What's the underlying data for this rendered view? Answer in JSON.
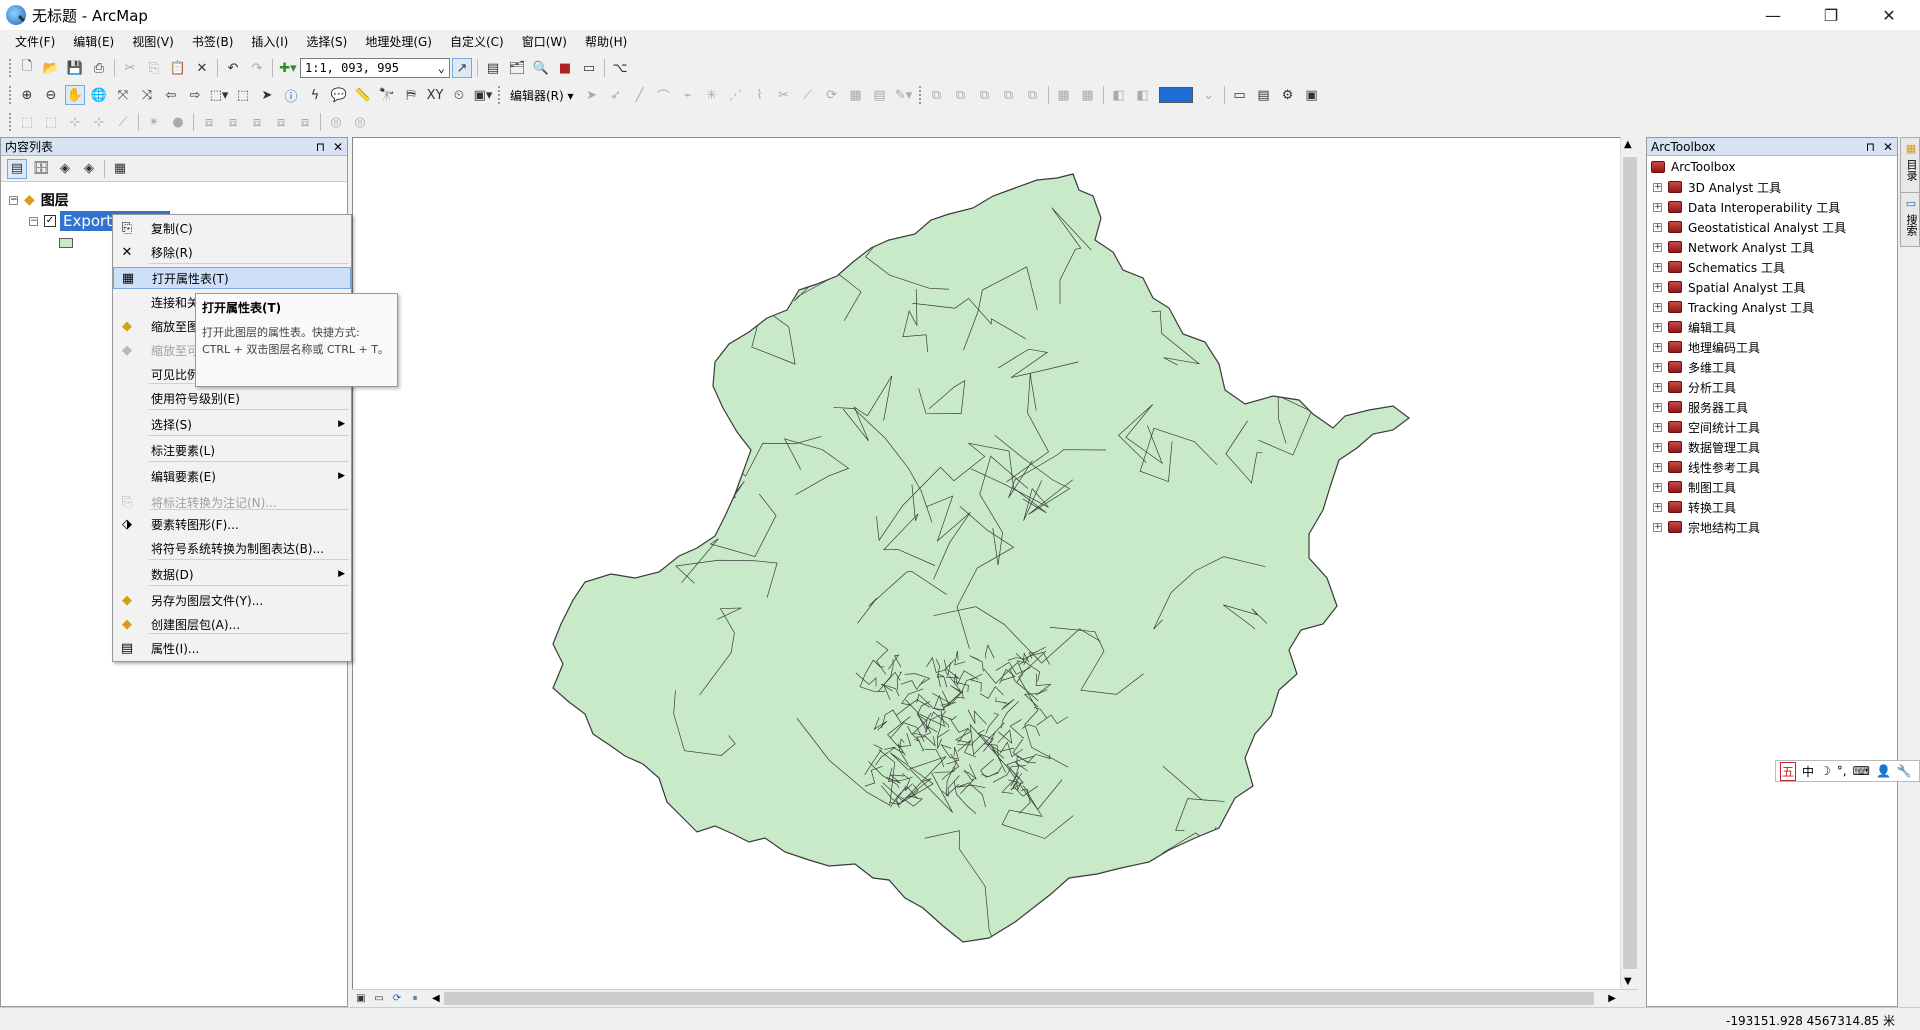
{
  "window": {
    "title": "无标题 - ArcMap",
    "minimize": "—",
    "maximize": "❐",
    "close": "✕"
  },
  "menu": [
    "文件(F)",
    "编辑(E)",
    "视图(V)",
    "书签(B)",
    "插入(I)",
    "选择(S)",
    "地理处理(G)",
    "自定义(C)",
    "窗口(W)",
    "帮助(H)"
  ],
  "toolbar": {
    "scale": "1:1, 093, 995",
    "editor_label": "编辑器(R) ▾"
  },
  "toc": {
    "title": "内容列表",
    "pin": "⊓",
    "close": "✕",
    "root_label": "图层",
    "layer_name": "Export_"
  },
  "context_menu": [
    {
      "label": "复制(C)",
      "icon": "copy-icon",
      "glyph": "⎘",
      "enabled": true
    },
    {
      "label": "移除(R)",
      "icon": "remove-icon",
      "glyph": "✕",
      "enabled": true
    },
    {
      "label": "打开属性表(T)",
      "icon": "table-icon",
      "glyph": "▦",
      "enabled": true,
      "highlighted": true
    },
    {
      "label": "连接和关联",
      "icon": "",
      "glyph": "",
      "enabled": true,
      "submenu": true
    },
    {
      "label": "缩放至图层",
      "icon": "zoom-layer-icon",
      "glyph": "◆",
      "enabled": true
    },
    {
      "label": "缩放至可见",
      "icon": "zoom-visible-icon",
      "glyph": "◆",
      "enabled": false
    },
    {
      "label": "可见比例范围",
      "icon": "",
      "glyph": "",
      "enabled": true,
      "submenu": true
    },
    {
      "label": "使用符号级别(E)",
      "icon": "",
      "glyph": "",
      "enabled": true
    },
    {
      "label": "选择(S)",
      "icon": "",
      "glyph": "",
      "enabled": true,
      "submenu": true
    },
    {
      "label": "标注要素(L)",
      "icon": "",
      "glyph": "",
      "enabled": true
    },
    {
      "label": "编辑要素(E)",
      "icon": "",
      "glyph": "",
      "enabled": true,
      "submenu": true
    },
    {
      "label": "将标注转换为注记(N)...",
      "icon": "convert-label-icon",
      "glyph": "⎘",
      "enabled": false
    },
    {
      "label": "要素转图形(F)...",
      "icon": "feature-graphic-icon",
      "glyph": "⬗",
      "enabled": true
    },
    {
      "label": "将符号系统转换为制图表达(B)...",
      "icon": "",
      "glyph": "",
      "enabled": true
    },
    {
      "label": "数据(D)",
      "icon": "",
      "glyph": "",
      "enabled": true,
      "submenu": true
    },
    {
      "label": "另存为图层文件(Y)...",
      "icon": "layer-file-icon",
      "glyph": "◆",
      "enabled": true
    },
    {
      "label": "创建图层包(A)...",
      "icon": "layer-package-icon",
      "glyph": "◆",
      "enabled": true
    },
    {
      "label": "属性(I)...",
      "icon": "properties-icon",
      "glyph": "▤",
      "enabled": true
    }
  ],
  "tooltip": {
    "title": "打开属性表(T)",
    "body": "打开此图层的属性表。快捷方式: CTRL + 双击图层名称或 CTRL + T。"
  },
  "toolbox": {
    "title": "ArcToolbox",
    "root": "ArcToolbox",
    "items": [
      "3D Analyst 工具",
      "Data Interoperability 工具",
      "Geostatistical Analyst 工具",
      "Network Analyst 工具",
      "Schematics 工具",
      "Spatial Analyst 工具",
      "Tracking Analyst 工具",
      "编辑工具",
      "地理编码工具",
      "多维工具",
      "分析工具",
      "服务器工具",
      "空间统计工具",
      "数据管理工具",
      "线性参考工具",
      "制图工具",
      "转换工具",
      "宗地结构工具"
    ]
  },
  "side_tabs": [
    "目录",
    "搜索"
  ],
  "ime": {
    "items": [
      "五",
      "中",
      "☽",
      "°,",
      "⌨",
      "👤",
      "🔧"
    ]
  },
  "status": {
    "coordinates": "-193151.928  4567314.85 米"
  },
  "colors": {
    "map_fill": "#c9eac8",
    "map_stroke": "#3a3a3a",
    "selection": "#3373d0"
  }
}
